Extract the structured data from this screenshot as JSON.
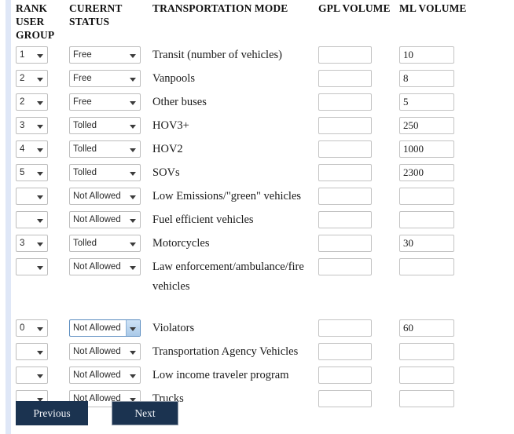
{
  "table": {
    "headers": {
      "rank": "RANK USER GROUP",
      "status": "CURERNT STATUS",
      "mode": "TRANSPORTATION MODE",
      "gpl": "GPL VOLUME",
      "ml": "ML VOLUME"
    },
    "rank_options": [
      "",
      "0",
      "1",
      "2",
      "3",
      "4",
      "5"
    ],
    "status_options": [
      "Free",
      "Tolled",
      "Not Allowed"
    ],
    "rows": [
      {
        "rank": "1",
        "status": "Free",
        "mode": "Transit (number of vehicles)",
        "gpl": "",
        "ml": "10",
        "tall": false,
        "focused": false
      },
      {
        "rank": "2",
        "status": "Free",
        "mode": "Vanpools",
        "gpl": "",
        "ml": "8",
        "tall": false,
        "focused": false
      },
      {
        "rank": "2",
        "status": "Free",
        "mode": "Other buses",
        "gpl": "",
        "ml": "5",
        "tall": false,
        "focused": false
      },
      {
        "rank": "3",
        "status": "Tolled",
        "mode": "HOV3+",
        "gpl": "",
        "ml": "250",
        "tall": false,
        "focused": false
      },
      {
        "rank": "4",
        "status": "Tolled",
        "mode": "HOV2",
        "gpl": "",
        "ml": "1000",
        "tall": false,
        "focused": false
      },
      {
        "rank": "5",
        "status": "Tolled",
        "mode": "SOVs",
        "gpl": "",
        "ml": "2300",
        "tall": false,
        "focused": false
      },
      {
        "rank": "",
        "status": "Not Allowed",
        "mode": "Low Emissions/\"green\" vehicles",
        "gpl": "",
        "ml": "",
        "tall": false,
        "focused": false
      },
      {
        "rank": "",
        "status": "Not Allowed",
        "mode": "Fuel efficient vehicles",
        "gpl": "",
        "ml": "",
        "tall": false,
        "focused": false
      },
      {
        "rank": "3",
        "status": "Tolled",
        "mode": "Motorcycles",
        "gpl": "",
        "ml": "30",
        "tall": false,
        "focused": false
      },
      {
        "rank": "",
        "status": "Not Allowed",
        "mode": "Law enforcement/ambulance/fire vehicles",
        "gpl": "",
        "ml": "",
        "tall": true,
        "focused": false
      },
      {
        "rank": "0",
        "status": "Not Allowed",
        "mode": "Violators",
        "gpl": "",
        "ml": "60",
        "tall": false,
        "focused": true
      },
      {
        "rank": "",
        "status": "Not Allowed",
        "mode": "Transportation Agency Vehicles",
        "gpl": "",
        "ml": "",
        "tall": false,
        "focused": false
      },
      {
        "rank": "",
        "status": "Not Allowed",
        "mode": "Low income traveler program",
        "gpl": "",
        "ml": "",
        "tall": false,
        "focused": false
      },
      {
        "rank": "",
        "status": "Not Allowed",
        "mode": "Trucks",
        "gpl": "",
        "ml": "",
        "tall": false,
        "focused": false
      }
    ]
  },
  "footer": {
    "previous_label": "Previous",
    "next_label": "Next"
  },
  "colors": {
    "button_background": "#1b3350",
    "button_text": "#f2f4f8",
    "left_rail": "#dfe7f7",
    "focused_select_accent": "#a9c9e8"
  }
}
